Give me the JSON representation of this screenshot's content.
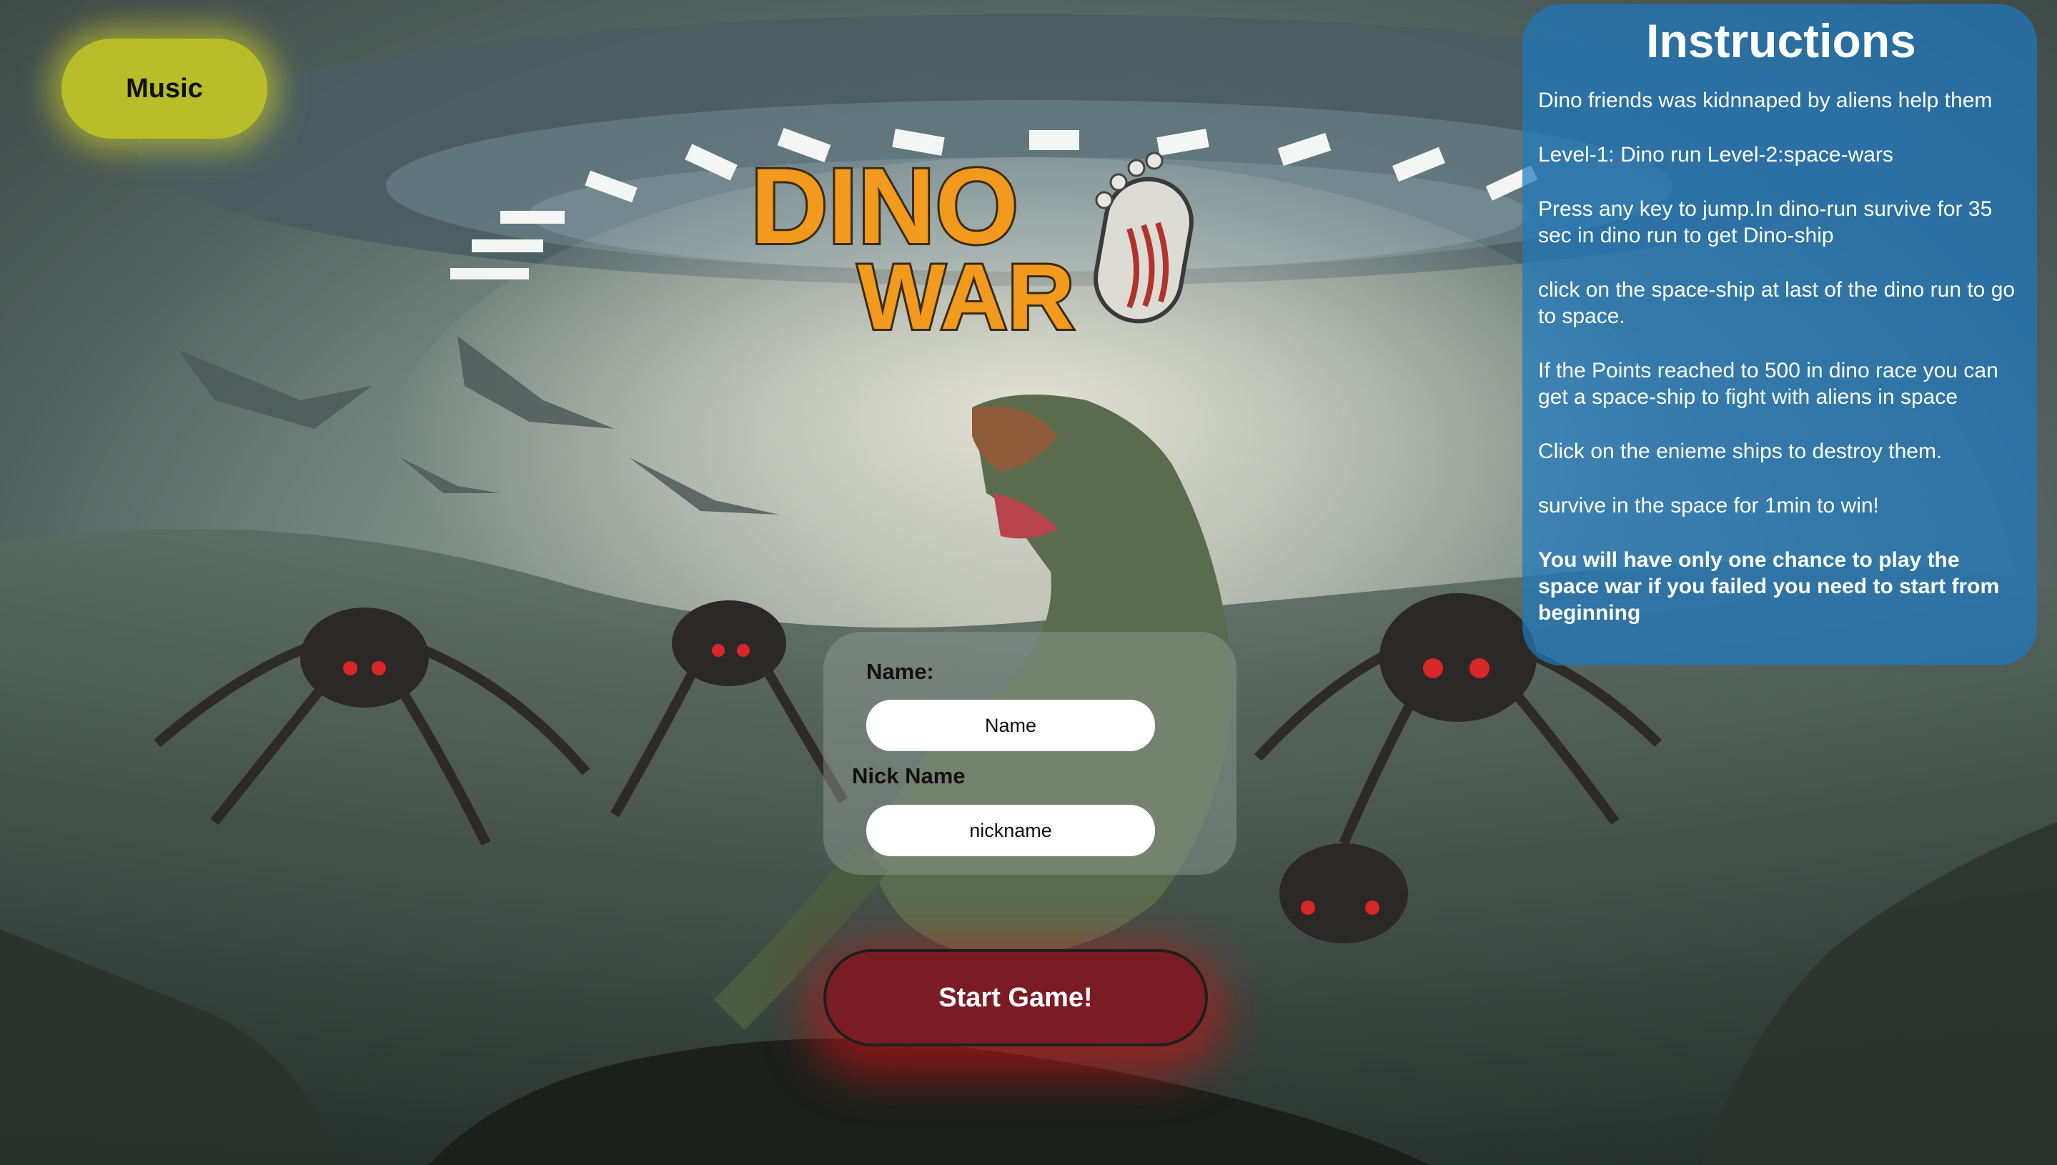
{
  "music": {
    "label": "Music"
  },
  "logo": {
    "line1": "DINO",
    "line2": "WAR"
  },
  "instructions": {
    "title": "Instructions",
    "lines": [
      "Dino friends was kidnnaped by aliens help them",
      "Level-1: Dino run Level-2:space-wars",
      "Press any key to jump.In dino-run survive for 35 sec in dino run to get Dino-ship",
      "click on the space-ship at last of the dino run to go to space.",
      "If the Points reached to 500 in dino race you can get a space-ship to fight with aliens in space",
      "Click on the enieme ships to destroy them.",
      "survive in the space for 1min to win!"
    ],
    "warning": "You will have only one chance to play the space war if you failed you need to start from beginning"
  },
  "form": {
    "name_label": "Name:",
    "name_placeholder": "Name",
    "nick_label": "Nick Name",
    "nick_placeholder": "nickname"
  },
  "start": {
    "label": "Start Game!"
  },
  "colors": {
    "music_button": "#b9bd2a",
    "instructions_panel": "#1e78be",
    "start_button": "#7b1c24",
    "logo_orange": "#f29a1d"
  }
}
